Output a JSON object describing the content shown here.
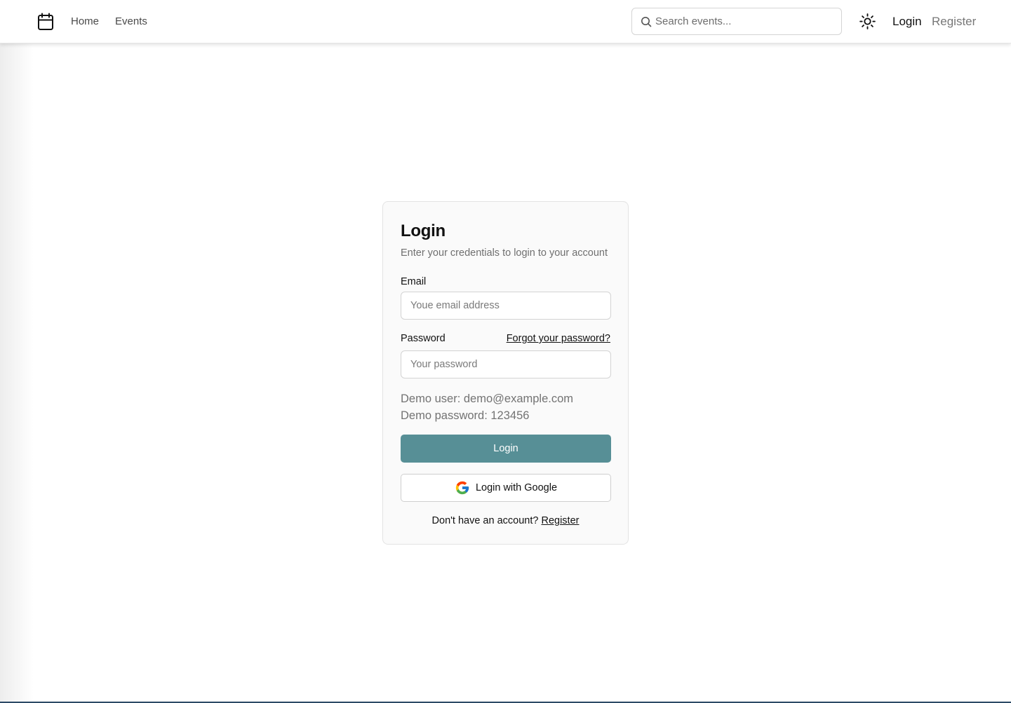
{
  "header": {
    "nav": {
      "home": "Home",
      "events": "Events"
    },
    "search": {
      "placeholder": "Search events..."
    },
    "login_link": "Login",
    "register_link": "Register",
    "icons": {
      "logo": "calendar-icon",
      "search": "search-icon",
      "theme": "sun-icon"
    }
  },
  "login_card": {
    "title": "Login",
    "subtitle": "Enter your credentials to login to your account",
    "email": {
      "label": "Email",
      "placeholder": "Youe email address",
      "value": ""
    },
    "password": {
      "label": "Password",
      "placeholder": "Your password",
      "value": "",
      "forgot_link": "Forgot your password?"
    },
    "demo_user": "Demo user: demo@example.com",
    "demo_password": "Demo password: 123456",
    "login_button": "Login",
    "google_button": "Login with Google",
    "signup_prompt": "Don't have an account?",
    "signup_link": "Register"
  },
  "colors": {
    "primary_button": "#578f96",
    "card_background": "#fafafa",
    "muted_text": "#6f6f6f"
  }
}
